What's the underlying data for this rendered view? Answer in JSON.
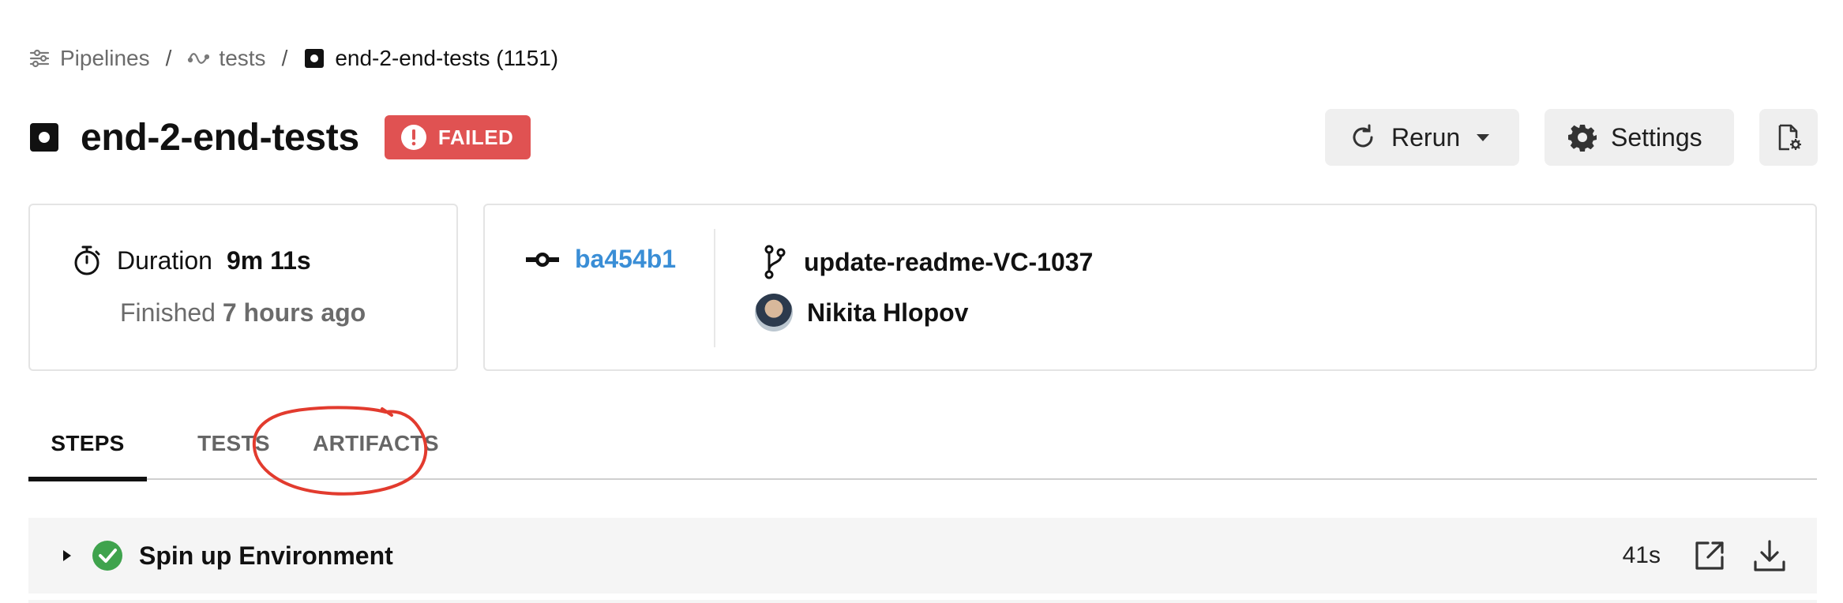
{
  "breadcrumb": {
    "items": [
      {
        "label": "Pipelines",
        "icon": "pipelines-icon"
      },
      {
        "label": "tests",
        "icon": "workflow-icon"
      },
      {
        "label": "end-2-end-tests (1151)",
        "icon": "job-icon"
      }
    ],
    "separator": "/"
  },
  "header": {
    "title": "end-2-end-tests",
    "status": "FAILED",
    "status_color": "#e05252",
    "buttons": {
      "rerun": "Rerun",
      "settings": "Settings"
    }
  },
  "summary": {
    "duration_label": "Duration",
    "duration_value": "9m 11s",
    "finished_label": "Finished",
    "finished_value": "7 hours ago"
  },
  "commit": {
    "sha": "ba454b1",
    "sha_color": "#3a8ed6",
    "branch": "update-readme-VC-1037",
    "author": "Nikita Hlopov"
  },
  "tabs": [
    {
      "label": "STEPS",
      "active": true
    },
    {
      "label": "TESTS",
      "active": false
    },
    {
      "label": "ARTIFACTS",
      "active": false
    }
  ],
  "annotation": {
    "color": "#e23b2e",
    "target": "ARTIFACTS"
  },
  "steps": [
    {
      "name": "Spin up Environment",
      "status": "success",
      "status_color": "#3fa34d",
      "duration": "41s"
    }
  ]
}
